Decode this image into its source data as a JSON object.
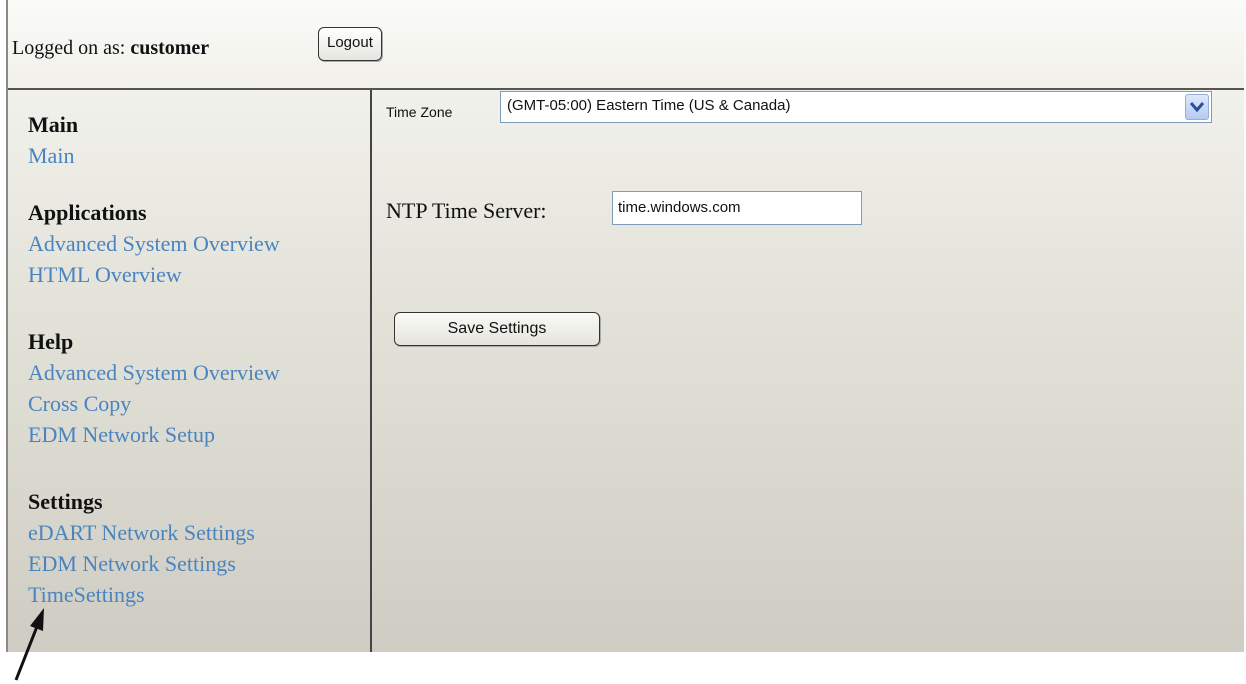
{
  "header": {
    "logged_prefix": "Logged on as: ",
    "username": "customer",
    "logout_label": "Logout"
  },
  "sidebar": {
    "sections": [
      {
        "heading": "Main",
        "items": [
          "Main"
        ]
      },
      {
        "heading": "Applications",
        "items": [
          "Advanced System Overview",
          "HTML Overview"
        ]
      },
      {
        "heading": "Help",
        "items": [
          "Advanced System Overview",
          "Cross Copy",
          "EDM Network Setup"
        ]
      },
      {
        "heading": "Settings",
        "items": [
          "eDART Network Settings",
          "EDM Network Settings",
          "TimeSettings"
        ]
      }
    ]
  },
  "form": {
    "timezone_label": "Time Zone",
    "timezone_value": "(GMT-05:00) Eastern Time (US & Canada)",
    "ntp_label": "NTP Time Server:",
    "ntp_value": "time.windows.com",
    "save_label": "Save Settings"
  },
  "colors": {
    "link": "#4a84c0",
    "text": "#111111"
  },
  "icons": {
    "dropdown": "chevron-down-icon",
    "annotation": "pointer-arrow-icon"
  }
}
